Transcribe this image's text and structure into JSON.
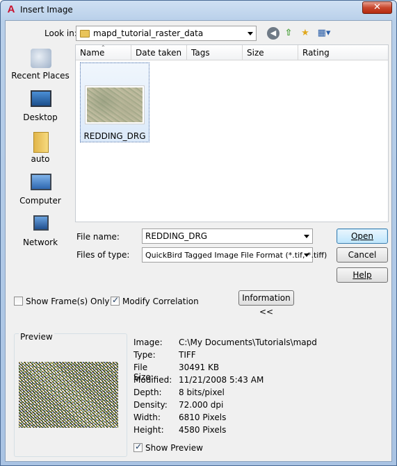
{
  "window": {
    "title": "Insert Image",
    "app_logo": "A",
    "close_glyph": "✕"
  },
  "look_in": {
    "label": "Look in:",
    "label_underline_char": "i",
    "value": "mapd_tutorial_raster_data"
  },
  "toolbar": {
    "icons": [
      "back-icon",
      "up-folder-icon",
      "new-folder-icon",
      "views-menu-icon"
    ]
  },
  "places": [
    {
      "label": "Recent Places",
      "icon": "recent-places-icon"
    },
    {
      "label": "Desktop",
      "icon": "desktop-icon"
    },
    {
      "label": "auto",
      "icon": "user-folder-icon"
    },
    {
      "label": "Computer",
      "icon": "computer-icon"
    },
    {
      "label": "Network",
      "icon": "network-icon"
    }
  ],
  "file_list": {
    "columns": [
      "Name",
      "Date taken",
      "Tags",
      "Size",
      "Rating"
    ],
    "sort_column": "Name",
    "items": [
      {
        "name": "REDDING_DRG",
        "selected": true
      }
    ]
  },
  "file_name": {
    "label": "File name:",
    "value": "REDDING_DRG"
  },
  "file_type": {
    "label": "Files of type:",
    "value": "QuickBird Tagged Image File Format (*.tif, *.tiff)"
  },
  "buttons": {
    "open": "Open",
    "cancel": "Cancel",
    "help": "Help",
    "information": "Information <<"
  },
  "options": {
    "show_frames_only": {
      "label": "Show Frame(s) Only",
      "checked": false
    },
    "modify_correlation": {
      "label": "Modify Correlation",
      "checked": true
    },
    "show_preview": {
      "label": "Show Preview",
      "checked": true
    }
  },
  "preview": {
    "title": "Preview"
  },
  "image_info": [
    {
      "key": "Image:",
      "value": "C:\\My Documents\\Tutorials\\mapd"
    },
    {
      "key": "Type:",
      "value": "TIFF"
    },
    {
      "key": "File Size:",
      "value": "30491 KB"
    },
    {
      "key": "Modified:",
      "value": "11/21/2008 5:43 AM"
    },
    {
      "key": "Depth:",
      "value": "8 bits/pixel"
    },
    {
      "key": "Density:",
      "value": "72.000 dpi"
    },
    {
      "key": "Width:",
      "value": "6810 Pixels"
    },
    {
      "key": "Height:",
      "value": "4580 Pixels"
    }
  ]
}
